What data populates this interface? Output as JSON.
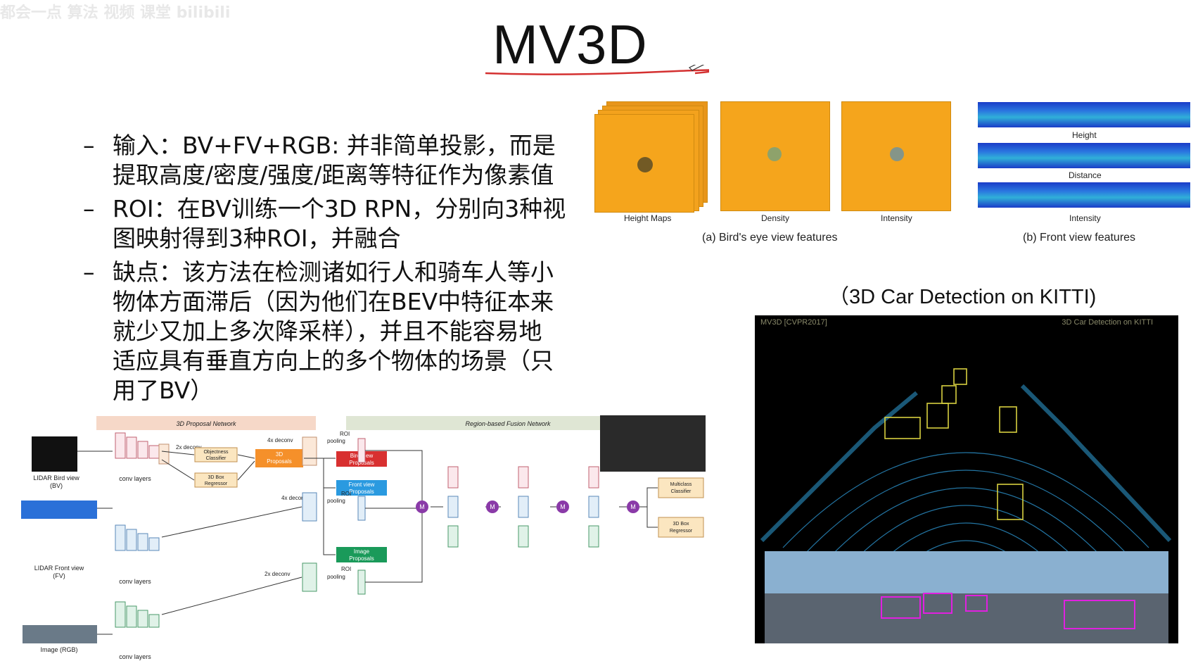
{
  "watermark": "都会一点 算法 视频 课堂 bilibili",
  "title": "MV3D",
  "bullets": [
    {
      "dash": "–",
      "lines": [
        "输入：BV+FV+RGB: 并非简单投影，而是",
        "提取高度/密度/强度/距离等特征作为像素值"
      ]
    },
    {
      "dash": "–",
      "lines": [
        "ROI：在BV训练一个3D RPN，分别向3种视",
        "图映射得到3种ROI，并融合"
      ]
    },
    {
      "dash": "–",
      "lines": [
        "缺点：该方法在检测诸如行人和骑车人等小",
        "物体方面滞后（因为他们在BEV中特征本来",
        "就少又加上多次降采样），并且不能容易地",
        "适应具有垂直方向上的多个物体的场景（只",
        "用了BV）"
      ]
    }
  ],
  "features": {
    "bev_labels": {
      "height_maps": "Height   Maps",
      "density": "Density",
      "intensity": "Intensity"
    },
    "bev_caption": "(a) Bird's eye view features",
    "fv_labels": {
      "height": "Height",
      "distance": "Distance",
      "intensity": "Intensity"
    },
    "fv_caption": "(b) Front view features",
    "colors": {
      "bev": "#f5a51c",
      "fv": "#1a3cc8"
    }
  },
  "kitti": {
    "caption": "（3D Car Detection on KITTI)",
    "overlay_left": "MV3D [CVPR2017]",
    "overlay_right": "3D Car Detection on KITTI"
  },
  "network": {
    "proposal_network": "3D Proposal Network",
    "fusion_network": "Region-based Fusion Network",
    "inputs": {
      "bv": "LIDAR Bird view",
      "bv_abbr": "(BV)",
      "fv": "LIDAR Front view",
      "fv_abbr": "(FV)",
      "rgb": "Image (RGB)"
    },
    "conv_layers": "conv layers",
    "deconv_4x": "4x deconv",
    "deconv_2x": "2x deconv",
    "roi_pooling_1": "ROI",
    "roi_pooling_2": "pooling",
    "objectness_1": "Objectness",
    "objectness_2": "Classifier",
    "box_reg_1": "3D Box",
    "box_reg_2": "Regressor",
    "proposals_1": "3D",
    "proposals_2": "Proposals",
    "bv_prop_1": "Bird view",
    "bv_prop_2": "Proposals",
    "fv_prop_1": "Front view",
    "fv_prop_2": "Proposals",
    "img_prop_1": "Image",
    "img_prop_2": "Proposals",
    "multiclass_1": "Multiclass",
    "multiclass_2": "Classifier",
    "box3d_1": "3D Box",
    "box3d_2": "Regressor",
    "merge_symbol": "M"
  }
}
